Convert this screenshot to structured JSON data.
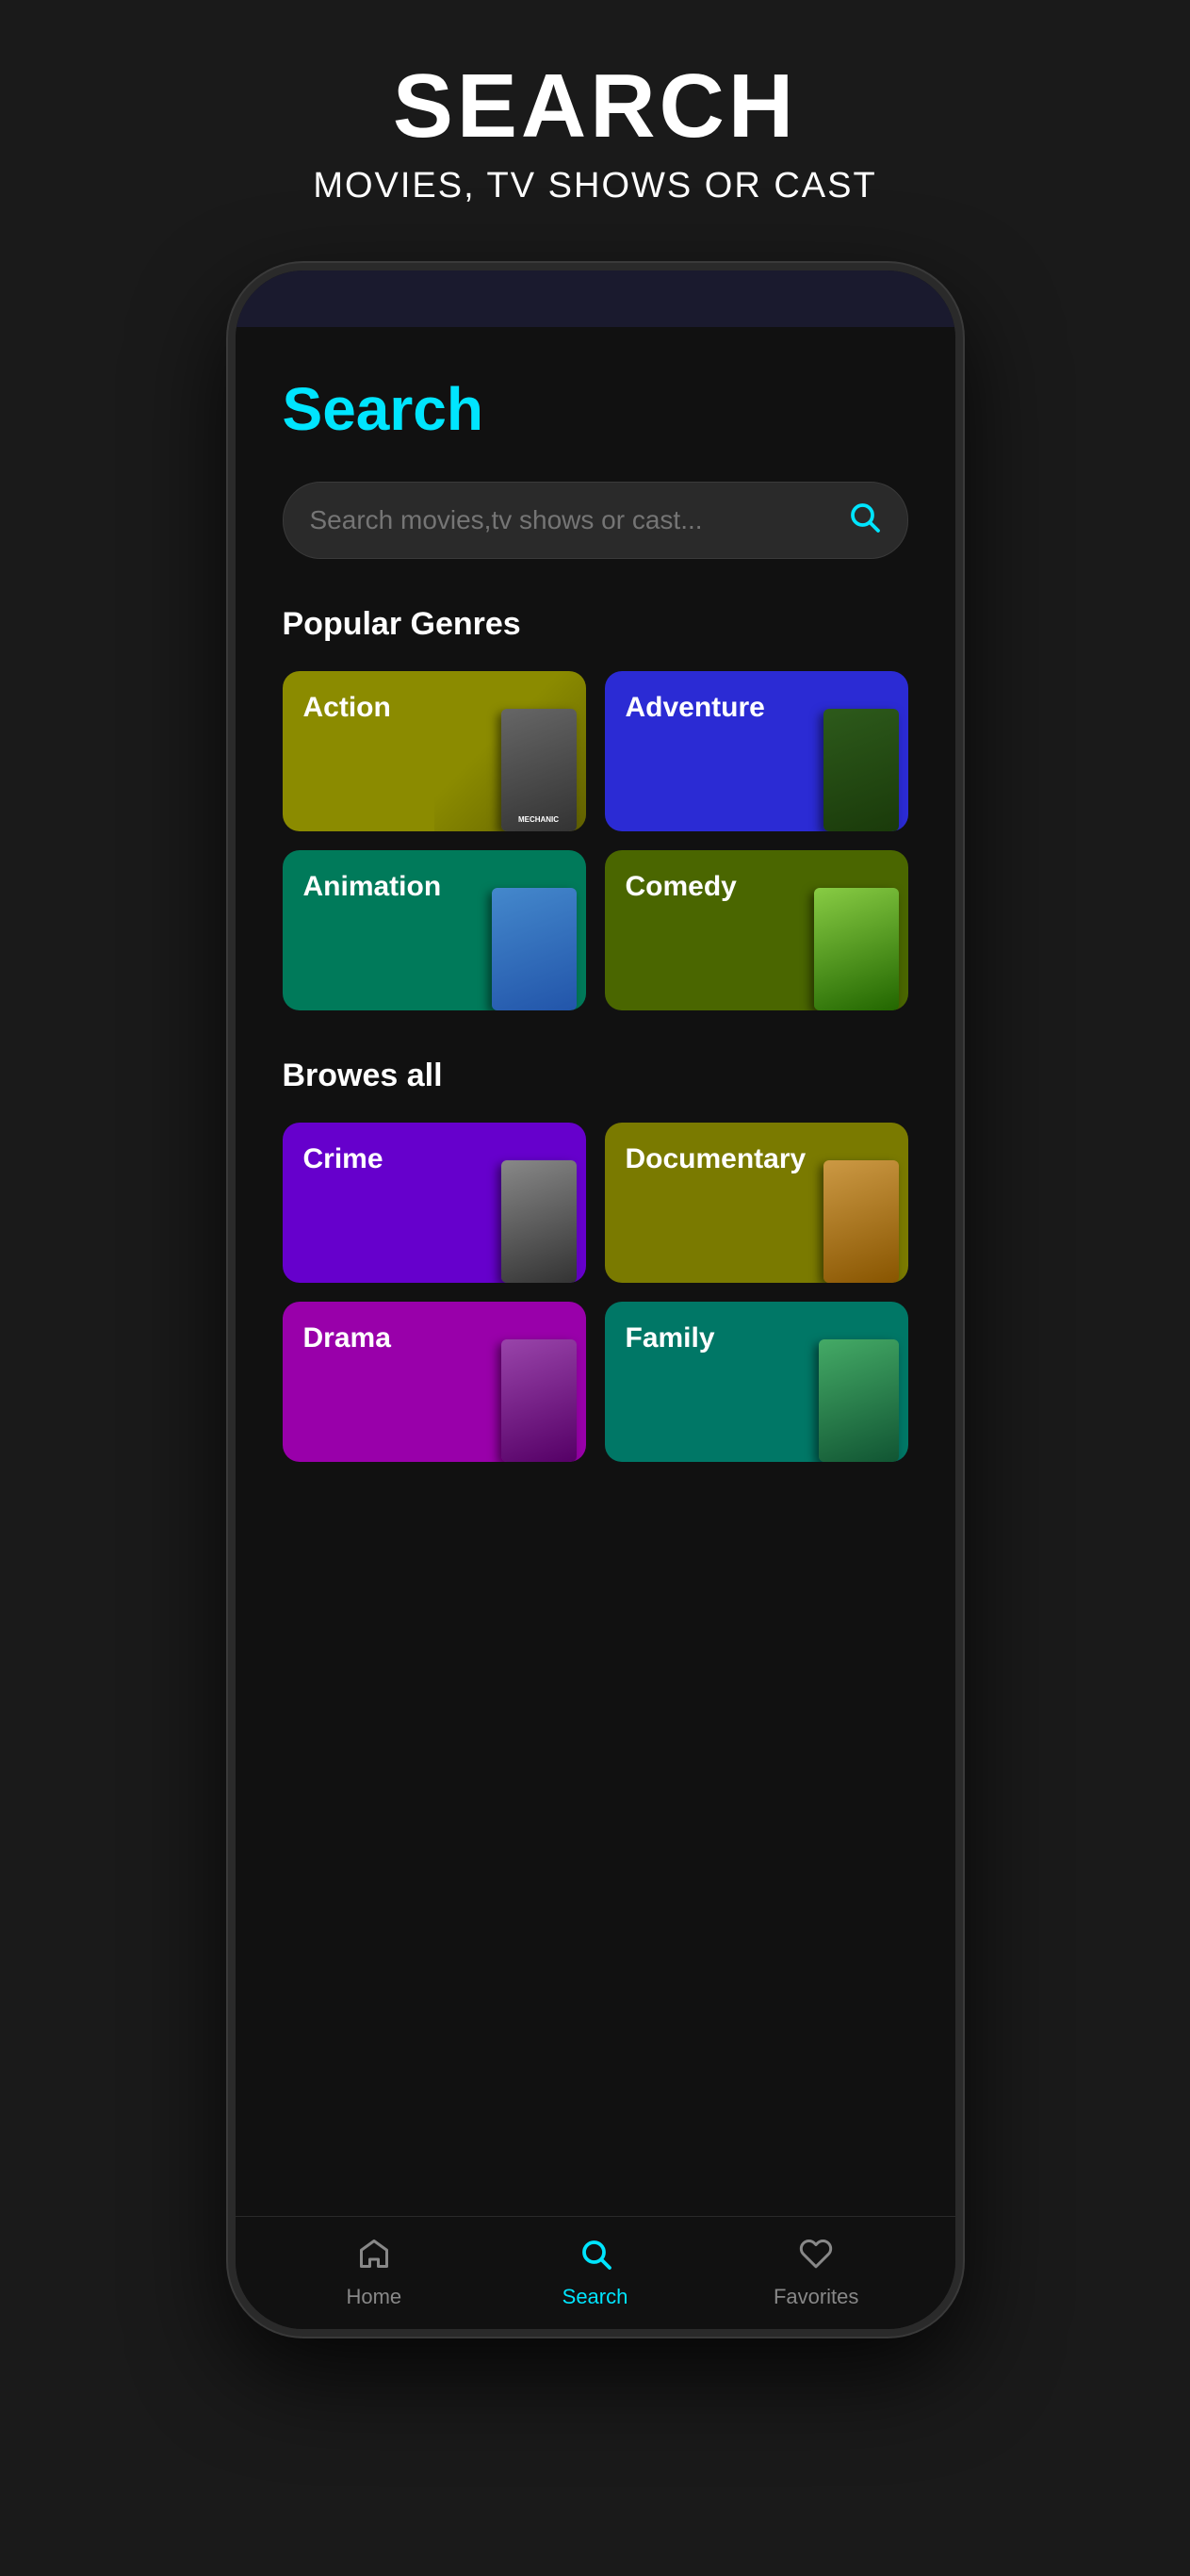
{
  "header": {
    "title": "SEARCH",
    "subtitle": "MOVIES, TV SHOWS OR CAST"
  },
  "page": {
    "title": "Search"
  },
  "searchBar": {
    "placeholder": "Search movies,tv shows or cast..."
  },
  "sections": {
    "popularGenres": {
      "label": "Popular Genres"
    },
    "browseAll": {
      "label": "Browes all"
    }
  },
  "popularGenres": [
    {
      "id": "action",
      "label": "Action",
      "bgColor": "#8b8b00",
      "poster": "mechanic"
    },
    {
      "id": "adventure",
      "label": "Adventure",
      "bgColor": "#2b2bd4",
      "poster": "jungle"
    },
    {
      "id": "animation",
      "label": "Animation",
      "bgColor": "#007a5a",
      "poster": "cinderella"
    },
    {
      "id": "comedy",
      "label": "Comedy",
      "bgColor": "#4a6600",
      "poster": "ricknmorty"
    }
  ],
  "browseAllGenres": [
    {
      "id": "crime",
      "label": "Crime",
      "bgColor": "#6600cc",
      "poster": "peaky"
    },
    {
      "id": "documentary",
      "label": "Documentary",
      "bgColor": "#7a7a00",
      "poster": "social"
    },
    {
      "id": "drama",
      "label": "Drama",
      "bgColor": "#9900aa",
      "poster": "drama"
    },
    {
      "id": "family",
      "label": "Family",
      "bgColor": "#007766",
      "poster": "malcolm"
    }
  ],
  "bottomNav": {
    "items": [
      {
        "id": "home",
        "label": "Home",
        "active": false
      },
      {
        "id": "search",
        "label": "Search",
        "active": true
      },
      {
        "id": "favorites",
        "label": "Favorites",
        "active": false
      }
    ]
  },
  "colors": {
    "accent": "#00e5ff",
    "background": "#111111",
    "outerBg": "#1a1a1a"
  }
}
